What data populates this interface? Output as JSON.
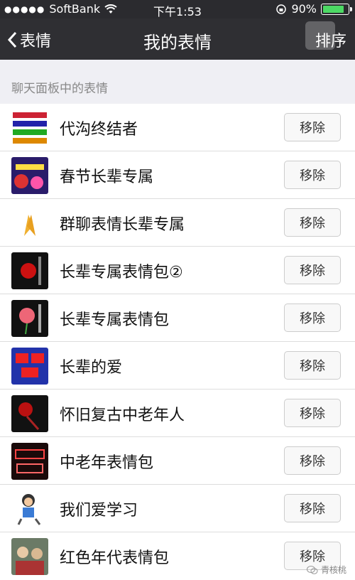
{
  "status": {
    "carrier": "SoftBank",
    "time": "下午1:53",
    "battery": "90%",
    "battery_level": 0.9
  },
  "nav": {
    "back_label": "表情",
    "title": "我的表情",
    "sort_label": "排序"
  },
  "section_title": "聊天面板中的表情",
  "remove_label": "移除",
  "rows": [
    {
      "label": "代沟终结者",
      "thumb": "rainbow-text-thumb"
    },
    {
      "label": "春节长辈专属",
      "thumb": "new-year-thumb"
    },
    {
      "label": "群聊表情长辈专属",
      "thumb": "praying-hands-thumb"
    },
    {
      "label": "长辈专属表情包②",
      "thumb": "red-rose-thumb"
    },
    {
      "label": "长辈专属表情包",
      "thumb": "pink-rose-thumb"
    },
    {
      "label": "长辈的爱",
      "thumb": "love-text-thumb"
    },
    {
      "label": "怀旧复古中老年人",
      "thumb": "dark-rose-thumb"
    },
    {
      "label": "中老年表情包",
      "thumb": "neon-text-thumb"
    },
    {
      "label": "我们爱学习",
      "thumb": "cartoon-student-thumb"
    },
    {
      "label": "红色年代表情包",
      "thumb": "retro-photo-thumb"
    }
  ],
  "watermark": "青核桃"
}
